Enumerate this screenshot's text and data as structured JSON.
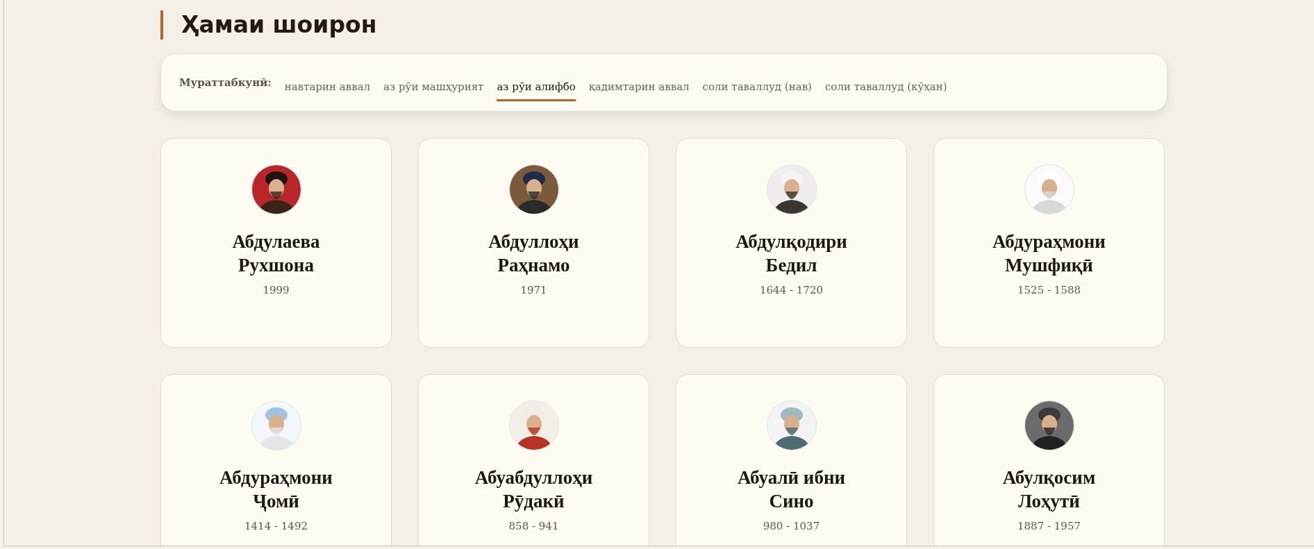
{
  "heading": "Ҳамаи шоирон",
  "sort_bar": {
    "label": "Мураттабкунӣ:",
    "options": [
      {
        "label": "навтарин аввал",
        "selected": false
      },
      {
        "label": "аз рӯи машҳурият",
        "selected": false
      },
      {
        "label": "аз рӯи алифбо",
        "selected": true
      },
      {
        "label": "қадимтарин аввал",
        "selected": false
      },
      {
        "label": "соли таваллуд (нав)",
        "selected": false
      },
      {
        "label": "соли таваллуд (кӯҳан)",
        "selected": false
      }
    ]
  },
  "poets": [
    {
      "name": "Абдулаева\nРухшона",
      "years": "1999"
    },
    {
      "name": "Абдуллоҳи\nРаҳнамо",
      "years": "1971"
    },
    {
      "name": "Абдулқодири\nБедил",
      "years": "1644 - 1720"
    },
    {
      "name": "Абдураҳмони\nМушфиқӣ",
      "years": "1525 - 1588"
    },
    {
      "name": "Абдураҳмони\nҶомӣ",
      "years": "1414 - 1492"
    },
    {
      "name": "Абуабдуллоҳи\nРӯдакӣ",
      "years": "858 - 941"
    },
    {
      "name": "Абуалӣ ибни\nСино",
      "years": "980 - 1037"
    },
    {
      "name": "Абулқосим\nЛоҳутӣ",
      "years": "1887 - 1957"
    }
  ]
}
